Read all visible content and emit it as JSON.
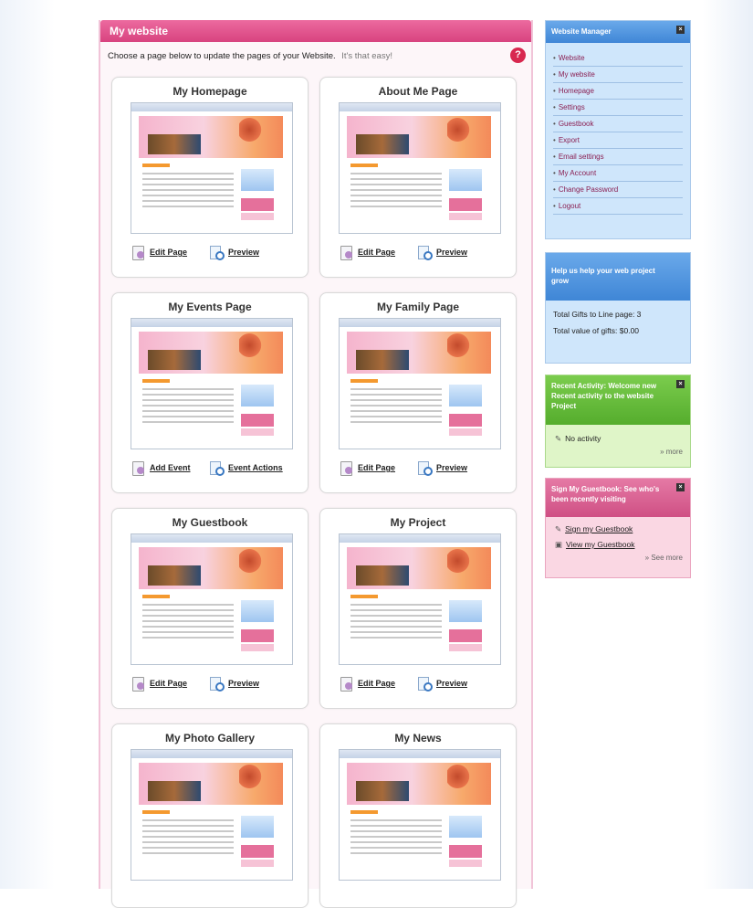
{
  "main": {
    "header": "My website",
    "intro": "Choose a page below to update the pages of your Website.",
    "easy": "It's that easy!",
    "help": "?"
  },
  "cards": [
    {
      "title": "My Homepage",
      "a1": "Edit Page",
      "a2": "Preview"
    },
    {
      "title": "About Me Page",
      "a1": "Edit Page",
      "a2": "Preview"
    },
    {
      "title": "My Events Page",
      "a1": "Add Event",
      "a2": "Event Actions"
    },
    {
      "title": "My Family Page",
      "a1": "Edit Page",
      "a2": "Preview"
    },
    {
      "title": "My Guestbook",
      "a1": "Edit Page",
      "a2": "Preview"
    },
    {
      "title": "My Project",
      "a1": "Edit Page",
      "a2": "Preview"
    },
    {
      "title": "My Photo Gallery",
      "a1": "",
      "a2": ""
    },
    {
      "title": "My News",
      "a1": "",
      "a2": ""
    }
  ],
  "sidebar": {
    "nav_title": "Website Manager",
    "nav_items": [
      "Website",
      "My website",
      "Homepage",
      "Settings",
      "Guestbook",
      "Export",
      "Email settings",
      "My Account",
      "Change Password",
      "Logout"
    ],
    "stats_title": "Help us help your web project grow",
    "stats_line1": "Total Gifts to Line page: 3",
    "stats_line2": "Total value of gifts: $0.00",
    "rec_title": "Recent Activity: Welcome new Recent activity to the website Project",
    "rec_item": "No activity",
    "rec_more": "more",
    "gb_title": "Sign My Guestbook: See who's been recently visiting",
    "gb_link1": "Sign my Guestbook",
    "gb_link2": "View my Guestbook",
    "gb_more": "See more"
  }
}
